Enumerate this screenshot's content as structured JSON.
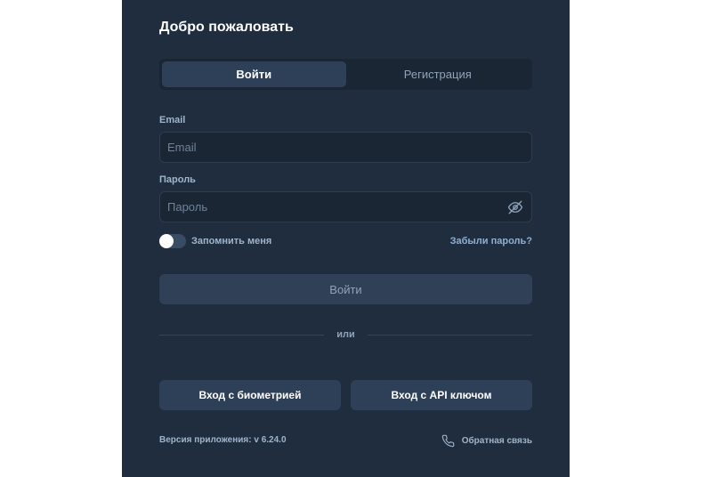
{
  "header": {
    "title": "Добро пожаловать"
  },
  "tabs": [
    {
      "label": "Войти",
      "active": true
    },
    {
      "label": "Регистрация",
      "active": false
    }
  ],
  "form": {
    "email": {
      "label": "Email",
      "placeholder": "Email",
      "value": ""
    },
    "password": {
      "label": "Пароль",
      "placeholder": "Пароль",
      "value": "",
      "toggle_icon": "eye-off-icon"
    },
    "remember": {
      "label": "Запомнить меня",
      "checked": false
    },
    "forgot_label": "Забыли пароль?",
    "submit_label": "Войти"
  },
  "divider": {
    "label": "или"
  },
  "alt_login": {
    "biometric_label": "Вход с биометрией",
    "api_key_label": "Вход с API ключом"
  },
  "footer": {
    "version_text": "Версия приложения: v 6.24.0",
    "feedback_label": "Обратная связь",
    "feedback_icon": "phone-icon"
  },
  "colors": {
    "panel_bg": "#1f2d3e",
    "input_bg": "#1a2634",
    "button_bg": "#2e4058",
    "label": "#9fb5cc"
  }
}
